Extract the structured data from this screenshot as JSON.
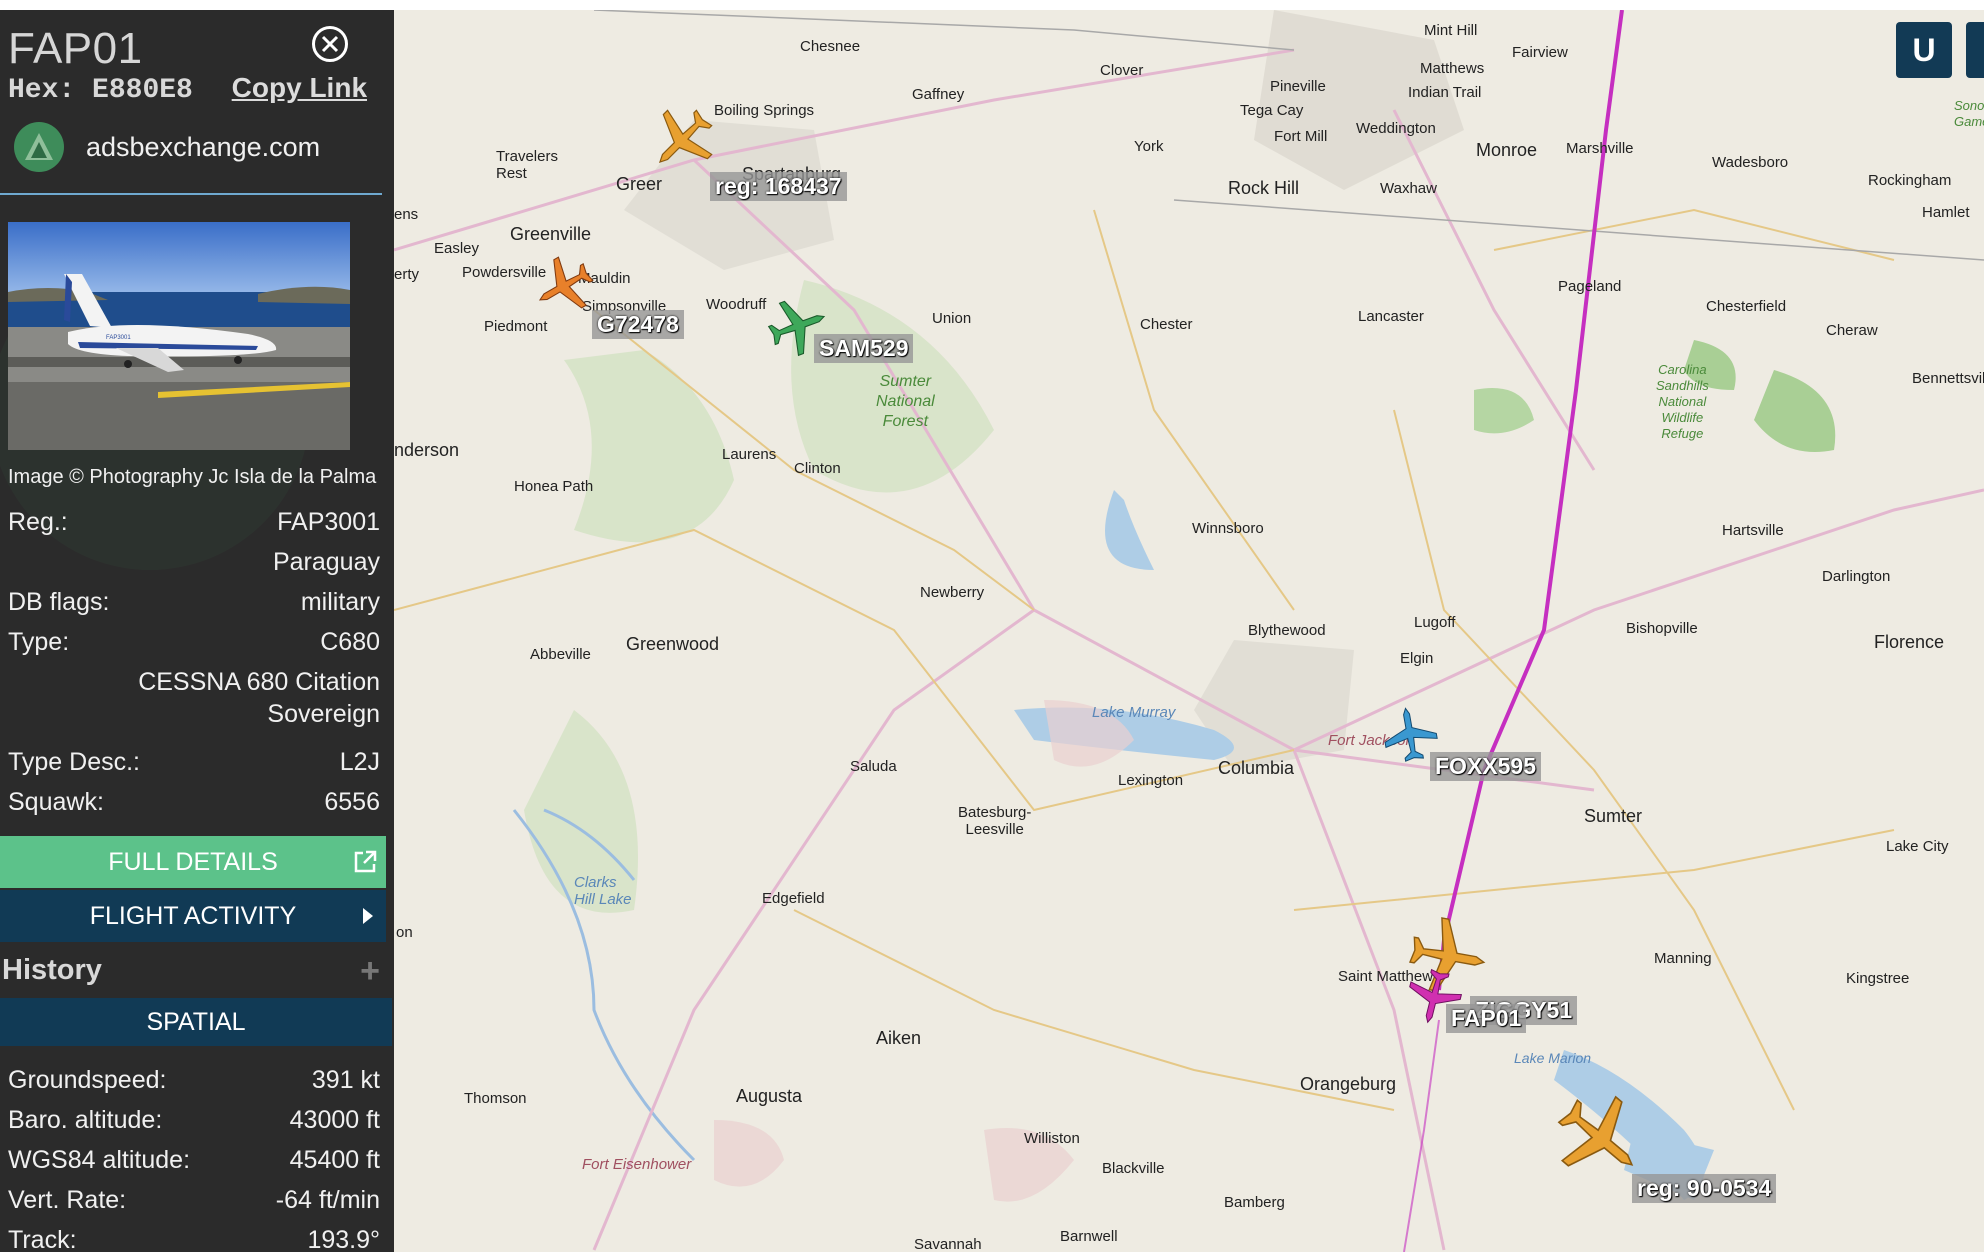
{
  "aircraft": {
    "callsign": "FAP01",
    "hex_label": "Hex:",
    "hex": "E880E8",
    "copy_link": "Copy Link",
    "source": "adsbexchange.com",
    "image_credit": "Image © Photography Jc Isla de la Palma",
    "photo_reg_text": "FAP3001",
    "reg_label": "Reg.:",
    "reg": "FAP3001",
    "country": "Paraguay",
    "db_flags_label": "DB flags:",
    "db_flags": "military",
    "type_label": "Type:",
    "type": "C680",
    "type_name_line1": "CESSNA 680 Citation",
    "type_name_line2": "Sovereign",
    "type_desc_label": "Type Desc.:",
    "type_desc": "L2J",
    "squawk_label": "Squawk:",
    "squawk": "6556"
  },
  "buttons": {
    "full_details": "FULL DETAILS",
    "flight_activity": "FLIGHT ACTIVITY",
    "history": "History",
    "spatial": "SPATIAL"
  },
  "spatial": {
    "groundspeed_label": "Groundspeed:",
    "groundspeed": "391 kt",
    "baro_label": "Baro. altitude:",
    "baro": "43000 ft",
    "wgs_label": "WGS84 altitude:",
    "wgs": "45400 ft",
    "vrate_label": "Vert. Rate:",
    "vrate": "-64 ft/min",
    "track_label": "Track:",
    "track": "193.9°"
  },
  "map_controls": {
    "u_button": "U"
  },
  "map_aircraft": [
    {
      "label": "reg: 168437",
      "color": "#e8a030"
    },
    {
      "label": "G72478",
      "color": "#e8802a"
    },
    {
      "label": "SAM529",
      "color": "#3ea85a"
    },
    {
      "label": "FOXX595",
      "color": "#3a98d0"
    },
    {
      "label": "ZIGGY51",
      "color": "#e8a030"
    },
    {
      "label": "FAP01",
      "color": "#d030b0"
    },
    {
      "label": "reg: 90-0534",
      "color": "#e8a030"
    }
  ],
  "places": {
    "chesnee": "Chesnee",
    "boiling_springs": "Boiling Springs",
    "gaffney": "Gaffney",
    "clover": "Clover",
    "mint_hill": "Mint Hill",
    "fairview": "Fairview",
    "matthews": "Matthews",
    "pineville": "Pineville",
    "indian_trail": "Indian Trail",
    "tega_cay": "Tega Cay",
    "fort_mill": "Fort Mill",
    "weddington": "Weddington",
    "monroe": "Monroe",
    "marshville": "Marshville",
    "wadesboro": "Wadesboro",
    "rockingham": "Rockingham",
    "hamlet": "Hamlet",
    "travelers_rest": "Travelers\nRest",
    "greer": "Greer",
    "spartanburg": "Spartanburg",
    "york": "York",
    "rock_hill": "Rock Hill",
    "waxhaw": "Waxhaw",
    "greenville": "Greenville",
    "easley": "Easley",
    "powdersville": "Powdersville",
    "mauldin": "Mauldin",
    "simpsonville": "Simpsonville",
    "woodruff": "Woodruff",
    "piedmont": "Piedmont",
    "union": "Union",
    "chester": "Chester",
    "lancaster": "Lancaster",
    "pageland": "Pageland",
    "chesterfield": "Chesterfield",
    "cheraw": "Cheraw",
    "bennettsville": "Bennettsvill",
    "sumter_nf": "Sumter\nNational\nForest",
    "carolina_sandhills": "Carolina\nSandhills\nNational\nWildlife\nRefuge",
    "anderson": "nderson",
    "laurens": "Laurens",
    "clinton": "Clinton",
    "honea_path": "Honea Path",
    "winnsboro": "Winnsboro",
    "hartsville": "Hartsville",
    "darlington": "Darlington",
    "newberry": "Newberry",
    "abbeville": "Abbeville",
    "greenwood": "Greenwood",
    "blythewood": "Blythewood",
    "lugoff": "Lugoff",
    "elgin": "Elgin",
    "bishopville": "Bishopville",
    "florence": "Florence",
    "lake_murray": "Lake Murray",
    "fort_jackson": "Fort Jackson",
    "saluda": "Saluda",
    "lexington": "Lexington",
    "columbia": "Columbia",
    "sumter": "Sumter",
    "lake_city": "Lake City",
    "batesburg": "Batesburg-\nLeesville",
    "clarks_hill": "Clarks\nHill Lake",
    "edgefield": "Edgefield",
    "saint_matthews": "Saint Matthews",
    "manning": "Manning",
    "kingstree": "Kingstree",
    "lake_marion": "Lake Marion",
    "aiken": "Aiken",
    "orangeburg": "Orangeburg",
    "thomson": "Thomson",
    "augusta": "Augusta",
    "williston": "Williston",
    "fort_eisenhower": "Fort Eisenhower",
    "blackville": "Blackville",
    "bamberg": "Bamberg",
    "barnwell": "Barnwell",
    "savannah": "Savannah",
    "ens": "ens",
    "erty": "erty",
    "on": "on",
    "sono": "Sono\nGame"
  }
}
